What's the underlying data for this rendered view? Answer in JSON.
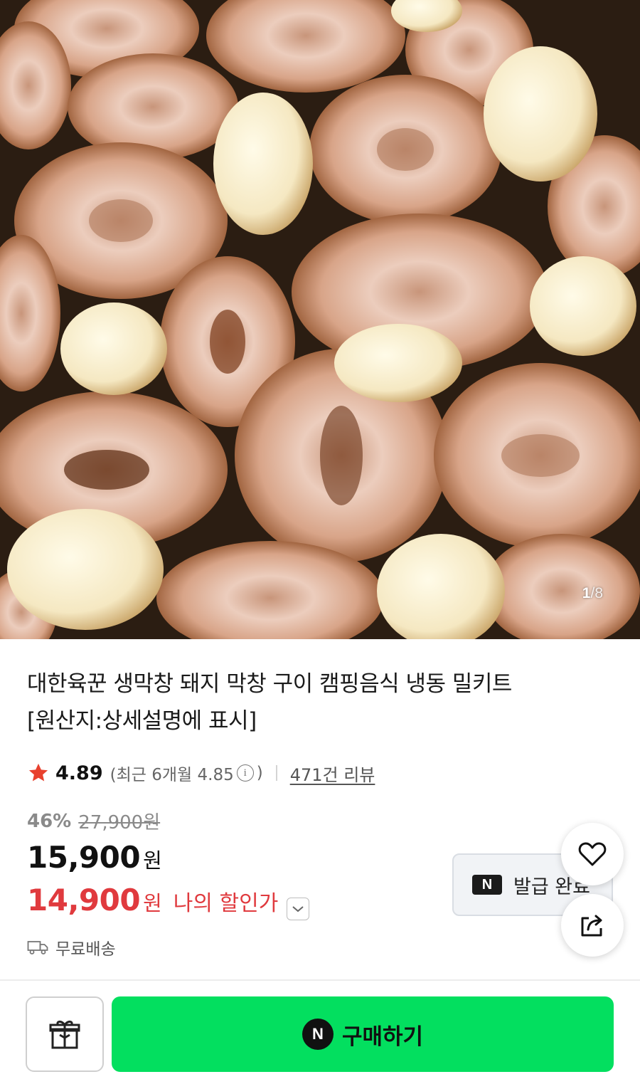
{
  "gallery": {
    "current": "1",
    "separator": "/",
    "total": "8"
  },
  "product": {
    "title_line1": "대한육꾼 생막창 돼지 막창 구이 캠핑음식 냉동 밀키트",
    "title_line2": "[원산지:상세설명에 표시]"
  },
  "rating": {
    "score": "4.89",
    "recent_prefix": "(최근 6개월 4.85",
    "recent_suffix": ")",
    "info_glyph": "i",
    "review_count": "471건 리뷰",
    "star_color": "#e8412e"
  },
  "pricing": {
    "discount_percent": "46%",
    "original_price": "27,900원",
    "sale_price": "15,900",
    "currency": "원",
    "my_price": "14,900",
    "my_price_label": "나의 할인가",
    "accent_red": "#e03a3e"
  },
  "shipping": {
    "label": "무료배송"
  },
  "coupon": {
    "badge": "N",
    "label": "발급 완료"
  },
  "bottom_bar": {
    "buy_badge": "N",
    "buy_label": "구매하기",
    "buy_color": "#03df5f"
  },
  "icons": [
    "star-icon",
    "info-icon",
    "chevron-down-icon",
    "truck-icon",
    "heart-icon",
    "share-icon",
    "gift-icon"
  ]
}
